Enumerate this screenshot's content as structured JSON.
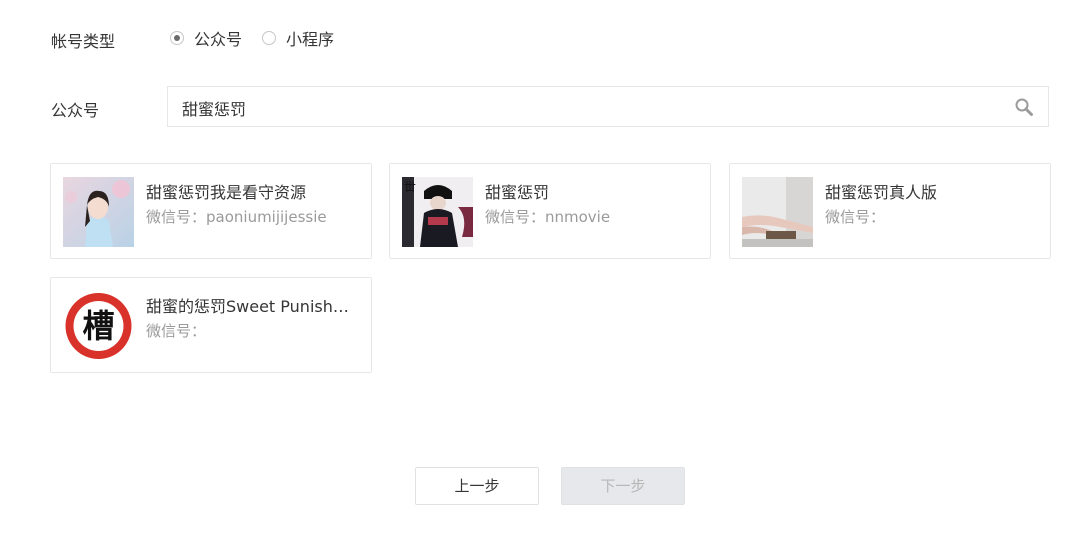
{
  "account_type": {
    "label": "帐号类型",
    "options": [
      {
        "label": "公众号",
        "checked": true
      },
      {
        "label": "小程序",
        "checked": false
      }
    ]
  },
  "search": {
    "label": "公众号",
    "value": "甜蜜惩罚",
    "icon": "search-icon"
  },
  "results": [
    {
      "name": "甜蜜惩罚我是看守资源",
      "wxid": "微信号：paoniumijijessie",
      "avatar": "portrait-photo"
    },
    {
      "name": "甜蜜惩罚",
      "wxid": "微信号：nnmovie",
      "avatar": "anime-poster"
    },
    {
      "name": "甜蜜惩罚真人版",
      "wxid": "微信号：",
      "avatar": "legs-photo"
    },
    {
      "name": "甜蜜的惩罚Sweet Punishm...",
      "wxid": "微信号：",
      "avatar": "red-circle-logo",
      "logo_char": "槽"
    }
  ],
  "buttons": {
    "prev": "上一步",
    "next": "下一步",
    "next_disabled": true
  },
  "colors": {
    "text": "#353535",
    "muted": "#9a9a9a",
    "border": "#e4e8eb",
    "disabled_bg": "#e7e8eb",
    "logo_red": "#d8322b"
  }
}
